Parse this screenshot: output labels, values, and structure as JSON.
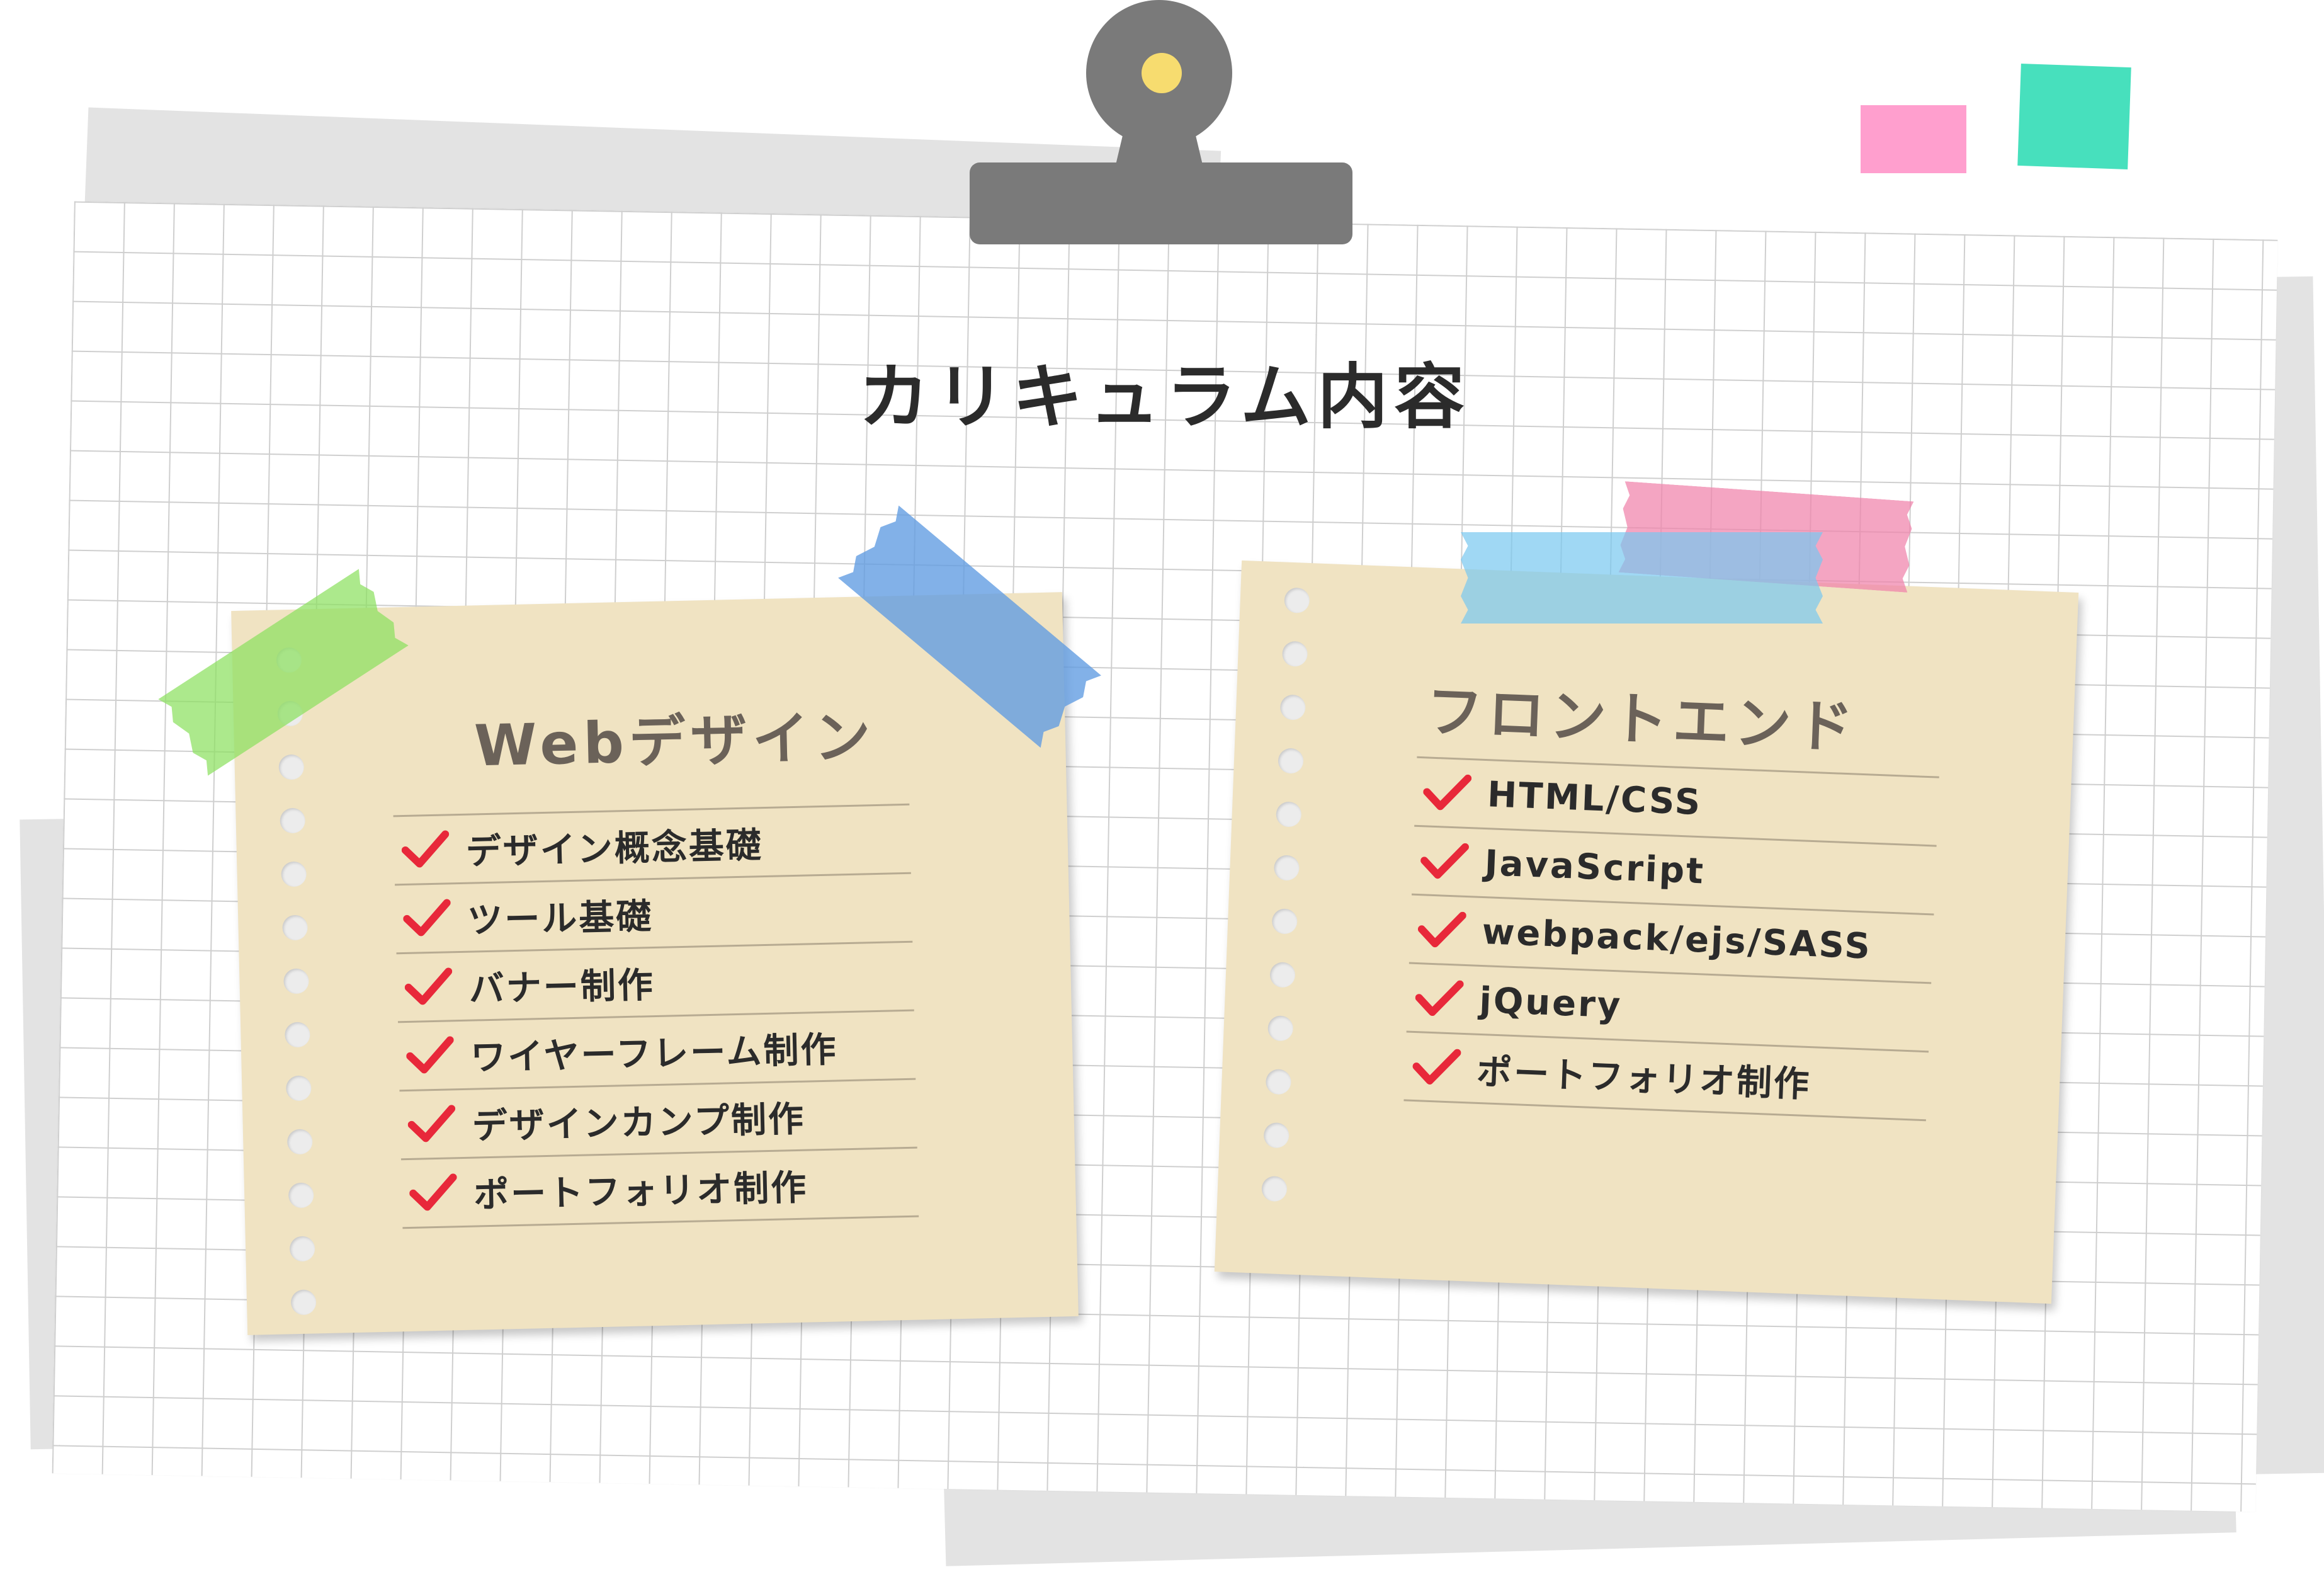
{
  "title": "カリキュラム内容",
  "colors": {
    "note_background": "#f0e3c2",
    "note_title": "#6b6259",
    "check_mark": "#e8283a",
    "clip": "#7a7a7a",
    "clip_dot": "#f7dc6f",
    "sticky_pink": "#ff9fce",
    "sticky_green": "#47e0bd",
    "tape_green": "#8ce15f",
    "tape_blue": "#5f9be1",
    "tape_pink": "#f082aa",
    "tape_light_blue": "#78c8f0"
  },
  "cards": [
    {
      "title": "Webデザイン",
      "items": [
        "デザイン概念基礎",
        "ツール基礎",
        "バナー制作",
        "ワイヤーフレーム制作",
        "デザインカンプ制作",
        "ポートフォリオ制作"
      ]
    },
    {
      "title": "フロントエンド",
      "items": [
        "HTML/CSS",
        "JavaScript",
        "webpack/ejs/SASS",
        "jQuery",
        "ポートフォリオ制作"
      ]
    }
  ],
  "icons": {
    "check": "check-icon",
    "clip": "binder-clip-icon"
  }
}
